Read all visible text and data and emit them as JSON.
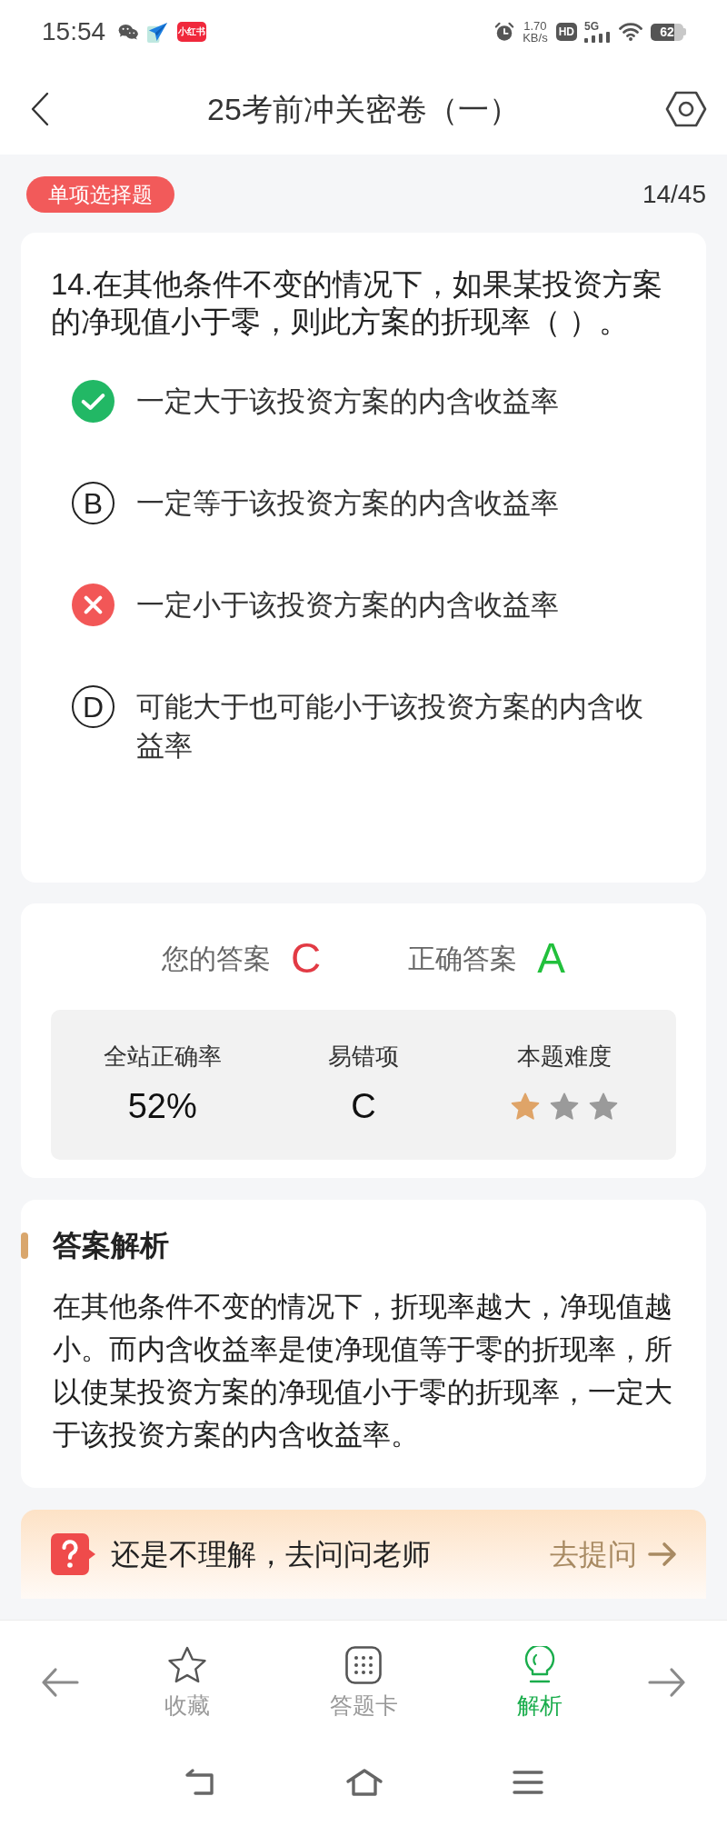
{
  "status_bar": {
    "time": "15:54",
    "app_badge": "小红书",
    "net_speed": [
      "1.70",
      "KB/s"
    ],
    "hd_badge": "HD",
    "network_type": "5G",
    "battery": "62"
  },
  "header": {
    "title": "25考前冲关密卷（一）"
  },
  "question": {
    "type_badge": "单项选择题",
    "counter": "14/45",
    "text": "14.在其他条件不变的情况下，如果某投资方案的净现值小于零，则此方案的折现率（ ）。",
    "options": [
      {
        "kind": "correct",
        "text": "一定大于该投资方案的内含收益率"
      },
      {
        "kind": "letter",
        "label": "B",
        "text": "一定等于该投资方案的内含收益率"
      },
      {
        "kind": "wrong",
        "text": "一定小于该投资方案的内含收益率"
      },
      {
        "kind": "letter",
        "label": "D",
        "text": "可能大于也可能小于该投资方案的内含收益率"
      }
    ]
  },
  "answer": {
    "your_answer_label": "您的答案",
    "your_answer": "C",
    "correct_answer_label": "正确答案",
    "correct_answer": "A",
    "stats": [
      {
        "kind": "text",
        "label": "全站正确率",
        "value": "52%"
      },
      {
        "kind": "text",
        "label": "易错项",
        "value": "C"
      },
      {
        "kind": "stars",
        "label": "本题难度",
        "stars": 1
      }
    ]
  },
  "analysis": {
    "title": "答案解析",
    "text": "在其他条件不变的情况下，折现率越大，净现值越小。而内含收益率是使净现值等于零的折现率，所以使某投资方案的净现值小于零的折现率，一定大于该投资方案的内含收益率。"
  },
  "ask_teacher": {
    "text": "还是不理解，去问问老师",
    "action": "去提问"
  },
  "bottom_nav": {
    "tabs": [
      {
        "label": "收藏",
        "selected": false
      },
      {
        "label": "答题卡",
        "selected": false
      },
      {
        "label": "解析",
        "selected": true
      }
    ]
  }
}
